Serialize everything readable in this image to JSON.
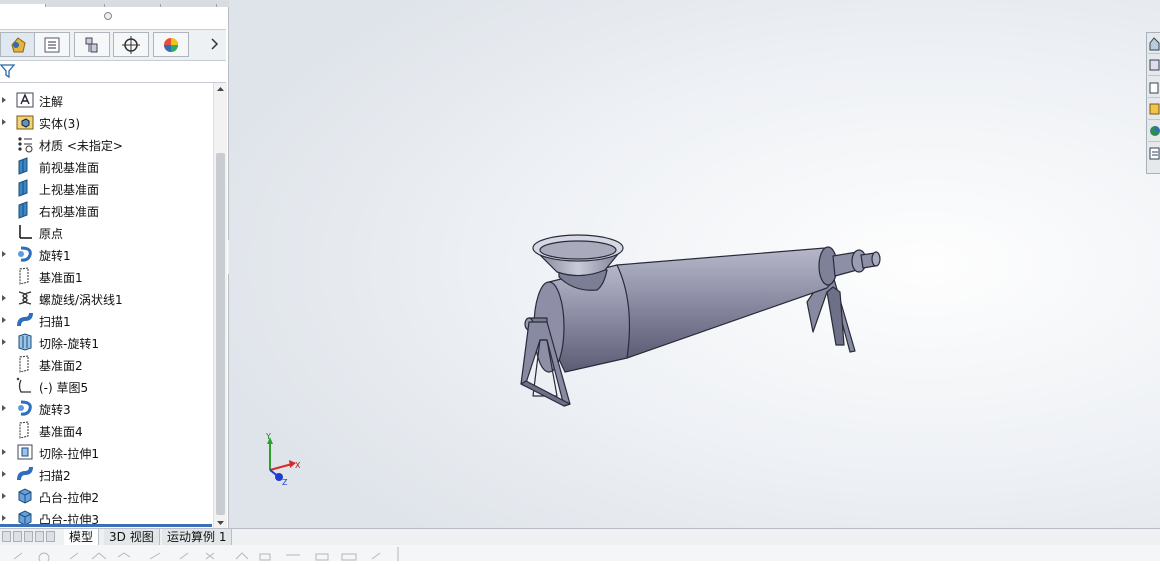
{
  "feature_manager": {
    "tree": [
      {
        "label": "注解",
        "icon": "annotation-icon",
        "expand": true
      },
      {
        "label": "实体(3)",
        "icon": "solid-bodies-icon",
        "expand": true
      },
      {
        "label": "材质 <未指定>",
        "icon": "material-icon",
        "expand": false
      },
      {
        "label": "前视基准面",
        "icon": "plane-icon",
        "expand": false
      },
      {
        "label": "上视基准面",
        "icon": "plane-icon",
        "expand": false
      },
      {
        "label": "右视基准面",
        "icon": "plane-icon",
        "expand": false
      },
      {
        "label": "原点",
        "icon": "origin-icon",
        "expand": false
      },
      {
        "label": "旋转1",
        "icon": "revolve-icon",
        "expand": true
      },
      {
        "label": "基准面1",
        "icon": "ref-plane-icon",
        "expand": false
      },
      {
        "label": "螺旋线/涡状线1",
        "icon": "helix-icon",
        "expand": true
      },
      {
        "label": "扫描1",
        "icon": "sweep-icon",
        "expand": true
      },
      {
        "label": "切除-旋转1",
        "icon": "cut-revolve-icon",
        "expand": true
      },
      {
        "label": "基准面2",
        "icon": "ref-plane-icon",
        "expand": false
      },
      {
        "label": "(-) 草图5",
        "icon": "sketch-icon",
        "expand": false
      },
      {
        "label": "旋转3",
        "icon": "revolve-icon",
        "expand": true
      },
      {
        "label": "基准面4",
        "icon": "ref-plane-icon",
        "expand": false
      },
      {
        "label": "切除-拉伸1",
        "icon": "cut-extrude-icon",
        "expand": true
      },
      {
        "label": "扫描2",
        "icon": "sweep-icon",
        "expand": true
      },
      {
        "label": "凸台-拉伸2",
        "icon": "boss-extrude-icon",
        "expand": true
      },
      {
        "label": "凸台-拉伸3",
        "icon": "boss-extrude-icon",
        "expand": true
      }
    ]
  },
  "bottom_tabs": [
    "模型",
    "3D 视图",
    "运动算例 1"
  ],
  "triad": {
    "x": "X",
    "y": "Y",
    "z": "Z"
  },
  "colors": {
    "accent": "#3b6fb6",
    "model": "#8c8da4"
  }
}
